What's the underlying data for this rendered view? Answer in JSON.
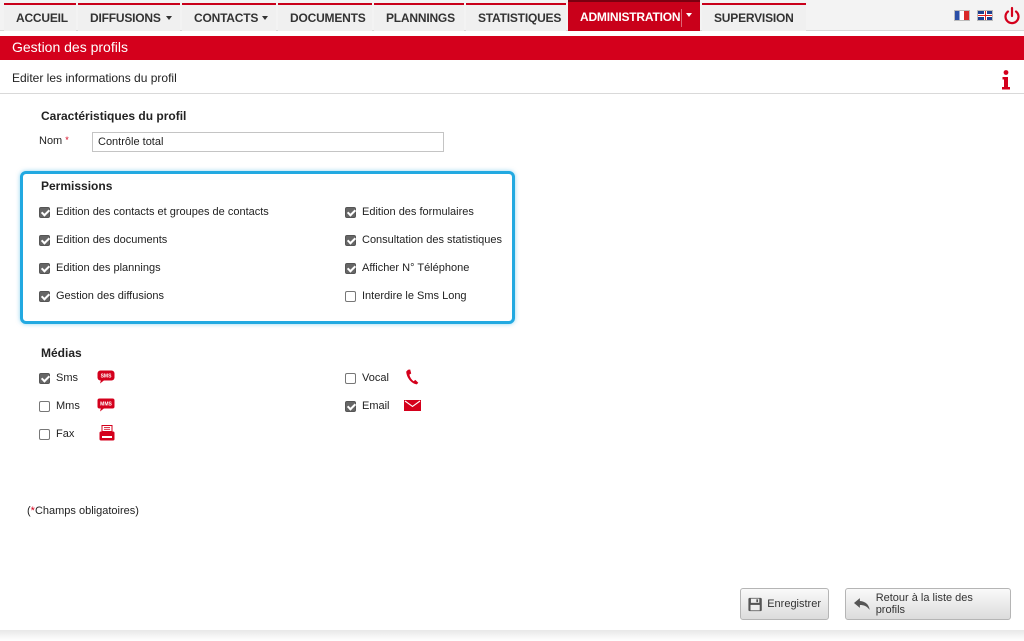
{
  "nav": {
    "tabs": [
      "ACCUEIL",
      "DIFFUSIONS",
      "CONTACTS",
      "DOCUMENTS",
      "PLANNINGS",
      "STATISTIQUES",
      "ADMINISTRATION",
      "SUPERVISION"
    ],
    "active": "ADMINISTRATION"
  },
  "page": {
    "title": "Gestion des profils",
    "subtitle": "Editer les informations du profil"
  },
  "profile": {
    "section_title": "Caractéristiques du profil",
    "name_label": "Nom",
    "required_mark": "*",
    "name_value": "Contrôle total"
  },
  "permissions": {
    "section_title": "Permissions",
    "items": [
      {
        "label": "Edition des contacts et groupes de contacts",
        "checked": true
      },
      {
        "label": "Edition des documents",
        "checked": true
      },
      {
        "label": "Edition des plannings",
        "checked": true
      },
      {
        "label": "Gestion des diffusions",
        "checked": true
      },
      {
        "label": "Edition des formulaires",
        "checked": true
      },
      {
        "label": "Consultation des statistiques",
        "checked": true
      },
      {
        "label": "Afficher N° Téléphone",
        "checked": true
      },
      {
        "label": "Interdire le Sms Long",
        "checked": false
      }
    ]
  },
  "medias": {
    "section_title": "Médias",
    "items": [
      {
        "label": "Sms",
        "checked": true,
        "icon": "sms-icon",
        "icon_text": "SMS"
      },
      {
        "label": "Mms",
        "checked": false,
        "icon": "mms-icon",
        "icon_text": "MMS"
      },
      {
        "label": "Fax",
        "checked": false,
        "icon": "fax-icon"
      },
      {
        "label": "Vocal",
        "checked": false,
        "icon": "phone-icon"
      },
      {
        "label": "Email",
        "checked": true,
        "icon": "envelope-icon"
      }
    ]
  },
  "footnote": {
    "star": "*",
    "text": "Champs obligatoires)",
    "open_paren": "("
  },
  "buttons": {
    "save": "Enregistrer",
    "back": "Retour à la liste des profils"
  },
  "colors": {
    "brand_red": "#d4001c",
    "highlight_blue": "#22a9e1"
  }
}
